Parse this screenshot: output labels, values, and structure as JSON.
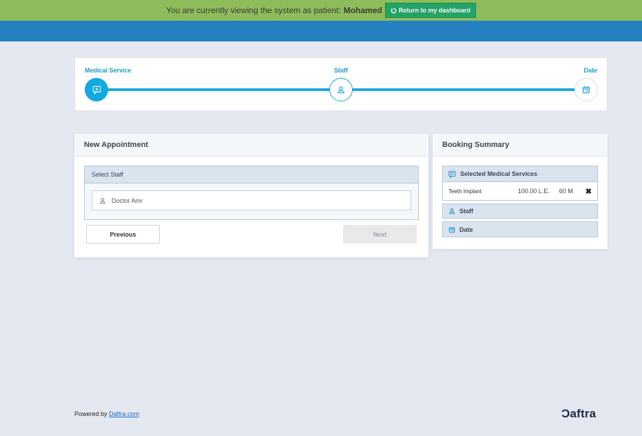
{
  "patient_bar": {
    "message": "You are currently viewing the system as patient:",
    "patient_name": "Mohamed",
    "return_label": "Return to my dashboard"
  },
  "steps": [
    {
      "label": "Medical Service",
      "icon": "chat-plus-icon",
      "state": "active"
    },
    {
      "label": "Staff",
      "icon": "user-icon",
      "state": "current"
    },
    {
      "label": "Date",
      "icon": "calendar-icon",
      "state": "pending"
    }
  ],
  "appointment": {
    "title": "New Appointment",
    "select_staff_label": "Select Staff",
    "staff_options": [
      "Doctor Amr"
    ],
    "previous_label": "Previous",
    "next_label": "Next"
  },
  "summary": {
    "title": "Booking Summary",
    "services_label": "Selected Medical Services",
    "services": [
      {
        "name": "Teeth Implant",
        "price": "100.00 L.E.",
        "duration": "60 M",
        "remove": "✖"
      }
    ],
    "staff_label": "Staff",
    "date_label": "Date"
  },
  "footer": {
    "powered_by": "Powered by",
    "link_text": "Daftra.com",
    "logo_text": "Ɔaftra"
  },
  "colors": {
    "patient_bar": "#8fbc5a",
    "return_button": "#23a365",
    "top_band": "#2480c1",
    "accent": "#1fa7dc",
    "background": "#e4e9f1"
  }
}
